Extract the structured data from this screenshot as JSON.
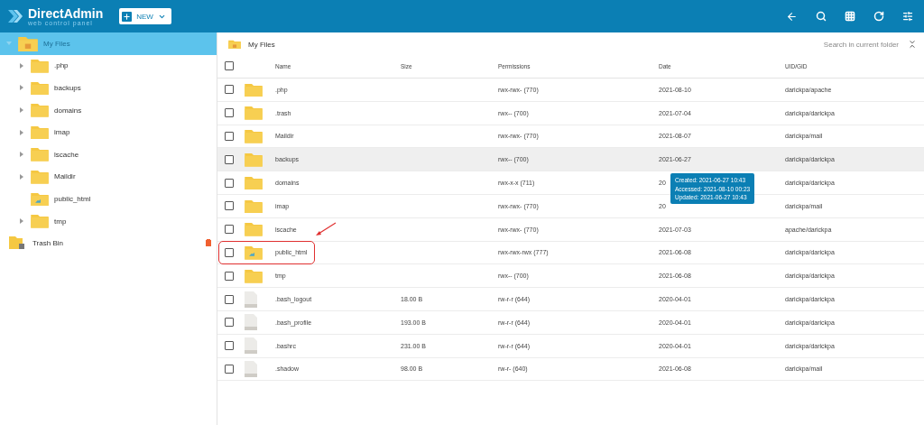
{
  "header": {
    "logo_title": "DirectAdmin",
    "logo_subtitle": "web control panel",
    "new_button": "NEW"
  },
  "sidebar": {
    "tree": [
      {
        "label": "My Files",
        "kind": "home",
        "expanded": true,
        "selected": true,
        "children": [
          {
            "label": ".php",
            "kind": "folder",
            "selected": false
          },
          {
            "label": "backups",
            "kind": "folder",
            "selected": false
          },
          {
            "label": "domains",
            "kind": "folder",
            "selected": false
          },
          {
            "label": "imap",
            "kind": "folder",
            "selected": false
          },
          {
            "label": "lscache",
            "kind": "folder",
            "selected": false
          },
          {
            "label": "Maildir",
            "kind": "folder",
            "selected": false
          },
          {
            "label": "public_html",
            "kind": "web-folder",
            "selected": false
          },
          {
            "label": "tmp",
            "kind": "folder",
            "selected": false
          }
        ]
      }
    ],
    "trash": {
      "label": "Trash Bin"
    }
  },
  "breadcrumb": "My Files",
  "search": {
    "placeholder": "Search in current folder"
  },
  "table": {
    "columns": [
      "Name",
      "Size",
      "Permissions",
      "Date",
      "UID/GID"
    ],
    "all_checked": false,
    "rows": [
      {
        "kind": "folder",
        "name": ".php",
        "size": "",
        "permissions": "rwx-rwx- (770)",
        "date": "2021-08-10",
        "owner": "darickpa/apache",
        "checked": false,
        "hovered": false,
        "circled": false
      },
      {
        "kind": "folder",
        "name": ".trash",
        "size": "",
        "permissions": "rwx-- (700)",
        "date": "2021-07-04",
        "owner": "darickpa/darickpa",
        "checked": false,
        "hovered": false,
        "circled": false
      },
      {
        "kind": "folder",
        "name": "Maildir",
        "size": "",
        "permissions": "rwx-rwx- (770)",
        "date": "2021-08-07",
        "owner": "darickpa/mail",
        "checked": false,
        "hovered": false,
        "circled": false
      },
      {
        "kind": "folder",
        "name": "backups",
        "size": "",
        "permissions": "rwx-- (700)",
        "date": "2021-06-27",
        "owner": "darickpa/darickpa",
        "checked": false,
        "hovered": true,
        "circled": false
      },
      {
        "kind": "folder",
        "name": "domains",
        "size": "",
        "permissions": "rwx-x-x (711)",
        "date": "20",
        "owner": "darickpa/darickpa",
        "checked": false,
        "hovered": false,
        "circled": false,
        "tooltip": [
          "Created: 2021-06-27 10:43",
          "Accessed: 2021-08-10 00:23",
          "Updated: 2021-06-27 10:43"
        ]
      },
      {
        "kind": "folder",
        "name": "imap",
        "size": "",
        "permissions": "rwx-rwx- (770)",
        "date": "20",
        "owner": "darickpa/mail",
        "checked": false,
        "hovered": false,
        "circled": false
      },
      {
        "kind": "folder",
        "name": "lscache",
        "size": "",
        "permissions": "rwx-rwx- (770)",
        "date": "2021-07-03",
        "owner": "apache/darickpa",
        "checked": false,
        "hovered": false,
        "circled": false
      },
      {
        "kind": "web-folder",
        "name": "public_html",
        "size": "",
        "permissions": "rwx-rwx-rwx (777)",
        "date": "2021-06-08",
        "owner": "darickpa/darickpa",
        "checked": false,
        "hovered": false,
        "circled": true
      },
      {
        "kind": "folder",
        "name": "tmp",
        "size": "",
        "permissions": "rwx-- (700)",
        "date": "2021-06-08",
        "owner": "darickpa/darickpa",
        "checked": false,
        "hovered": false,
        "circled": false
      },
      {
        "kind": "file",
        "name": ".bash_logout",
        "size": "18.00 B",
        "permissions": "rw-r-r (644)",
        "date": "2020-04-01",
        "owner": "darickpa/darickpa",
        "checked": false,
        "hovered": false,
        "circled": false
      },
      {
        "kind": "file",
        "name": ".bash_profile",
        "size": "193.00 B",
        "permissions": "rw-r-r (644)",
        "date": "2020-04-01",
        "owner": "darickpa/darickpa",
        "checked": false,
        "hovered": false,
        "circled": false
      },
      {
        "kind": "file",
        "name": ".bashrc",
        "size": "231.00 B",
        "permissions": "rw-r-r (644)",
        "date": "2020-04-01",
        "owner": "darickpa/darickpa",
        "checked": false,
        "hovered": false,
        "circled": false
      },
      {
        "kind": "file",
        "name": ".shadow",
        "size": "98.00 B",
        "permissions": "rw-r- (640)",
        "date": "2021-06-08",
        "owner": "darickpa/mail",
        "checked": false,
        "hovered": false,
        "circled": false
      }
    ]
  }
}
